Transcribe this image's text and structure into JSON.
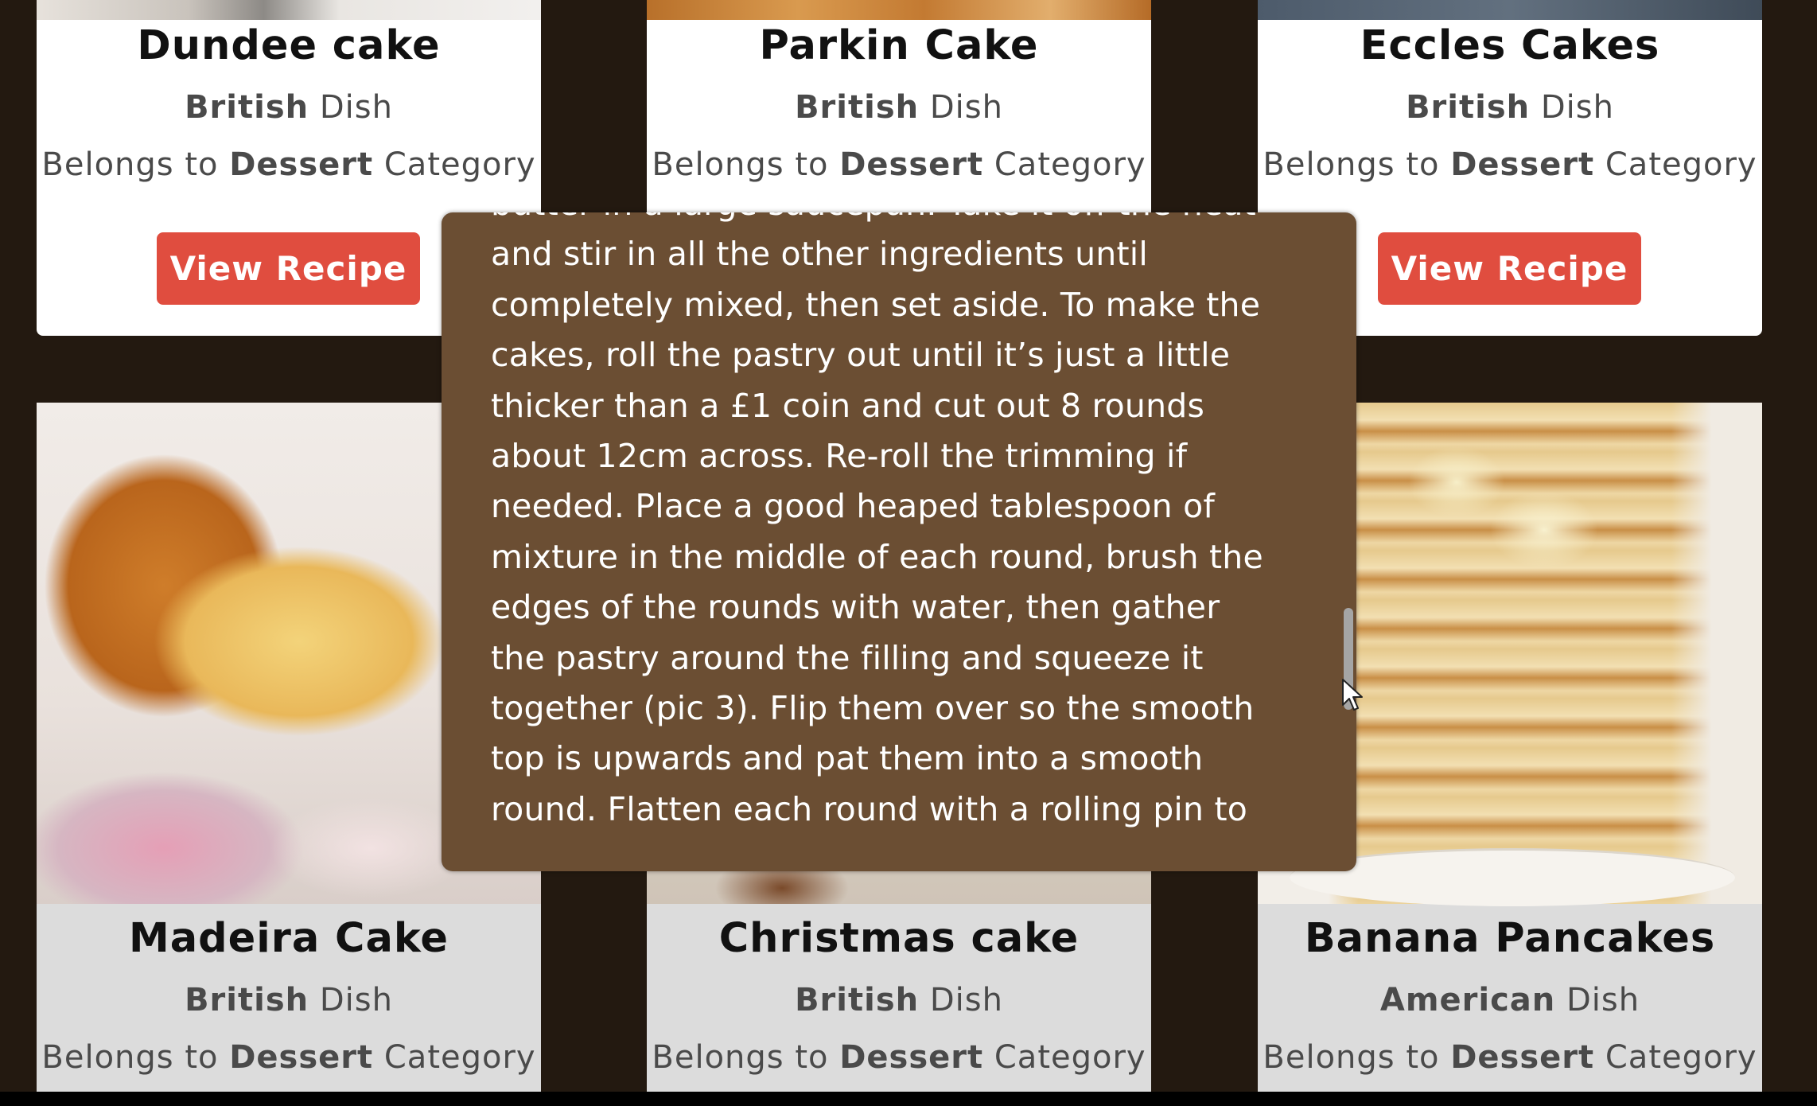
{
  "cards": [
    {
      "title": "Dundee cake",
      "origin": "British",
      "origin_suffix": "Dish",
      "category_prefix": "Belongs to",
      "category": "Dessert",
      "category_suffix": "Category",
      "button": "View Recipe"
    },
    {
      "title": "Parkin Cake",
      "origin": "British",
      "origin_suffix": "Dish",
      "category_prefix": "Belongs to",
      "category": "Dessert",
      "category_suffix": "Category"
    },
    {
      "title": "Eccles Cakes",
      "origin": "British",
      "origin_suffix": "Dish",
      "category_prefix": "Belongs to",
      "category": "Dessert",
      "category_suffix": "Category",
      "button": "View Recipe"
    },
    {
      "title": "Madeira Cake",
      "origin": "British",
      "origin_suffix": "Dish",
      "category_prefix": "Belongs to",
      "category": "Dessert",
      "category_suffix": "Category"
    },
    {
      "title": "Christmas cake",
      "origin": "British",
      "origin_suffix": "Dish",
      "category_prefix": "Belongs to",
      "category": "Dessert",
      "category_suffix": "Category"
    },
    {
      "title": "Banana Pancakes",
      "origin": "American",
      "origin_suffix": "Dish",
      "category_prefix": "Belongs to",
      "category": "Dessert",
      "category_suffix": "Category"
    }
  ],
  "modal": {
    "lines": [
      "butter in a large saucepan. Take it off the heat",
      "and stir in all the other ingredients until",
      "completely mixed, then set aside. To make the",
      "cakes, roll the pastry out until it’s just a little",
      "thicker than a £1 coin and cut out 8 rounds",
      "about 12cm across. Re-roll the trimming if",
      "needed. Place a good heaped tablespoon of",
      "mixture in the middle of each round, brush the",
      "edges of the rounds with water, then gather",
      "the pastry around the filling and squeeze it",
      "together (pic 3). Flip them over so the smooth",
      "top is upwards and pat them into a smooth",
      "round. Flatten each round with a rolling pin to"
    ]
  },
  "icons": {
    "cursor": "arrow-cursor-icon"
  }
}
